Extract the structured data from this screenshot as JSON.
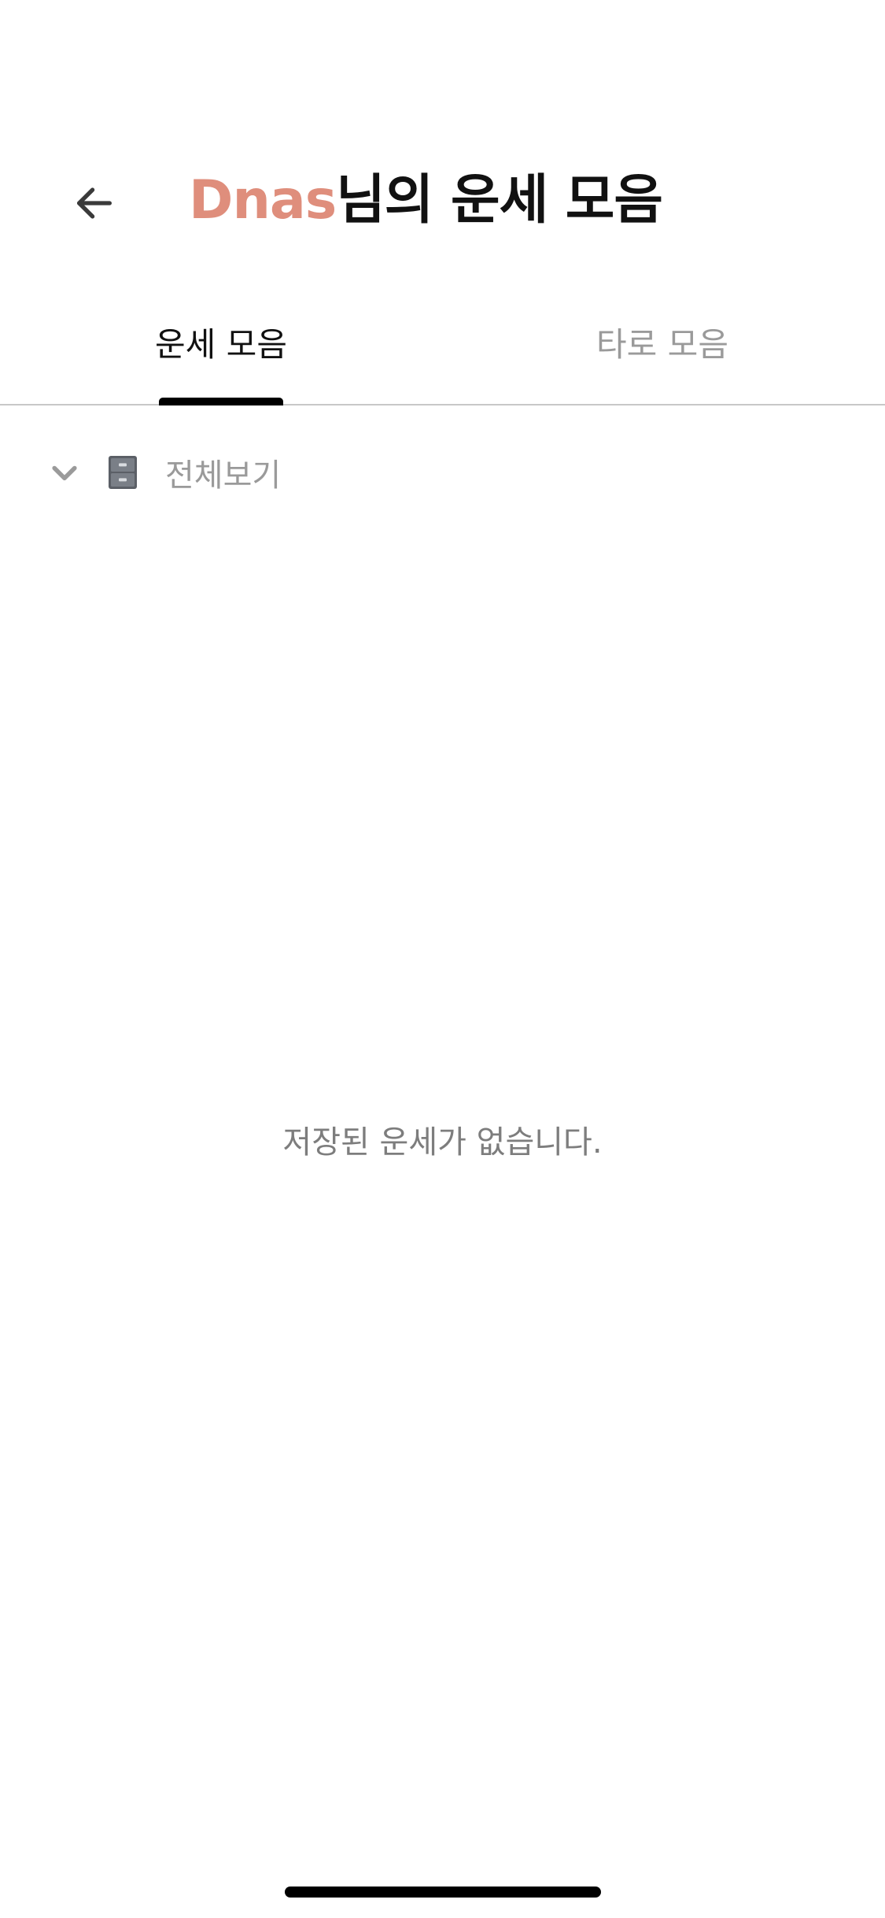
{
  "header": {
    "user_name": "Dnas",
    "title_suffix": "님의 운세 모음",
    "accent_color": "#df8e7c",
    "back_icon": "arrow-left-icon"
  },
  "tabs": [
    {
      "label": "운세 모음",
      "active": true
    },
    {
      "label": "타로 모음",
      "active": false
    }
  ],
  "filter": {
    "chevron_icon": "chevron-down-icon",
    "folder_icon": "file-cabinet-icon",
    "label": "전체보기"
  },
  "empty_state": {
    "message": "저장된 운세가 없습니다."
  }
}
